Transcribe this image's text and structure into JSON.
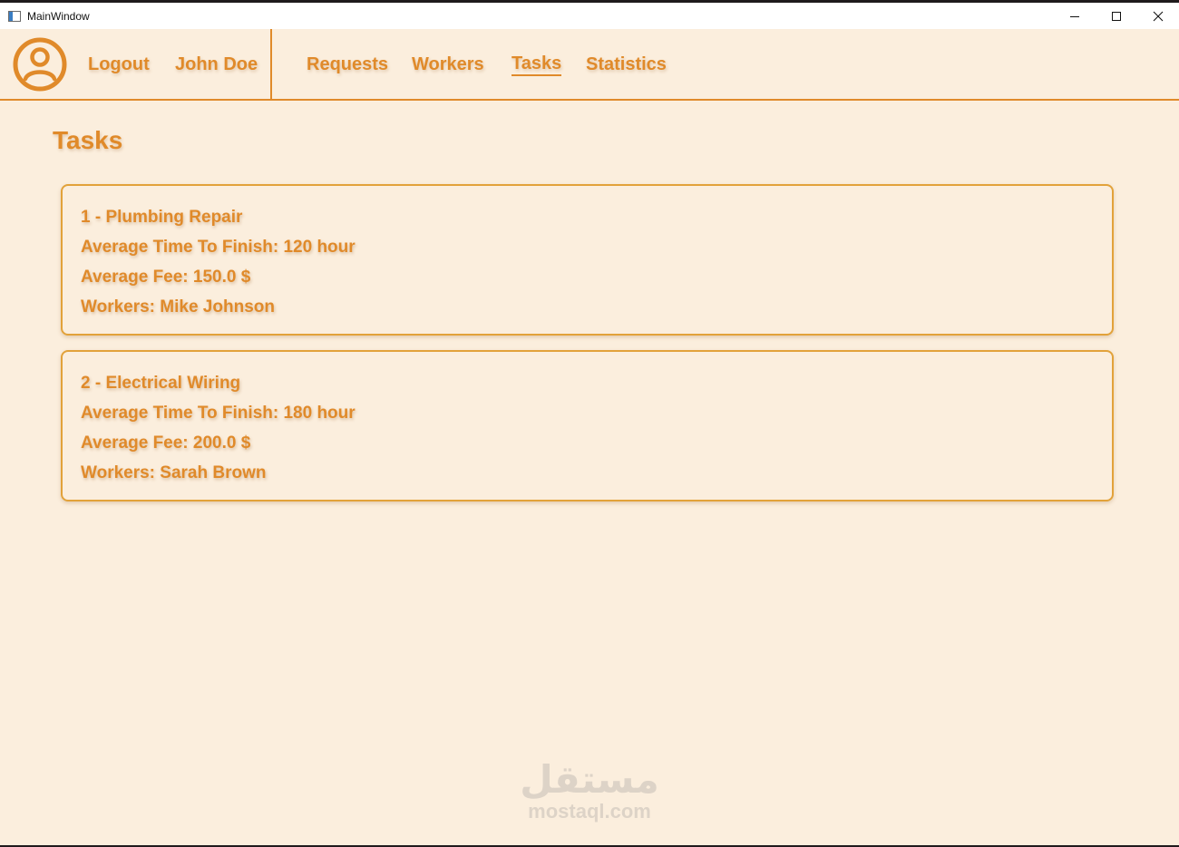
{
  "window": {
    "title": "MainWindow"
  },
  "nav": {
    "logout_label": "Logout",
    "user_name": "John Doe",
    "tabs": [
      {
        "label": "Requests",
        "active": false
      },
      {
        "label": "Workers",
        "active": false
      },
      {
        "label": "Tasks",
        "active": true
      },
      {
        "label": "Statistics",
        "active": false
      }
    ]
  },
  "page": {
    "title": "Tasks"
  },
  "tasks": [
    {
      "heading": "1 - Plumbing Repair",
      "avg_time": "Average Time To Finish: 120 hour",
      "avg_fee": "Average Fee: 150.0 $",
      "workers": "Workers: Mike Johnson"
    },
    {
      "heading": "2 - Electrical Wiring",
      "avg_time": "Average Time To Finish: 180 hour",
      "avg_fee": "Average Fee: 200.0 $",
      "workers": "Workers: Sarah Brown"
    }
  ],
  "watermark": {
    "arabic": "مستقل",
    "latin": "mostaql.com"
  },
  "colors": {
    "accent": "#e08a2a",
    "background": "#fbeedd",
    "card_border": "#e2a23a"
  }
}
